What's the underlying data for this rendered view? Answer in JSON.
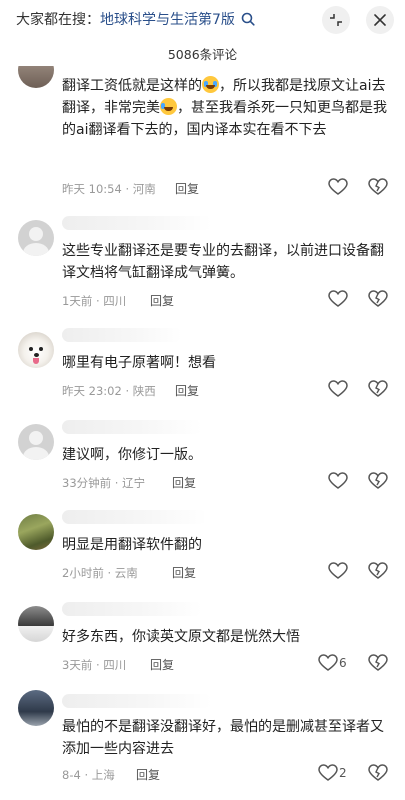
{
  "header": {
    "search_prefix": "大家都在搜：",
    "search_topic": "地球科学与生活第7版",
    "search_arrow": "Q",
    "comment_count": "5086条评论"
  },
  "icons": {
    "collapse": "collapse-icon",
    "close": "close-icon",
    "like": "heart-icon",
    "dislike": "broken-heart-icon"
  },
  "comments": [
    {
      "text_a": "翻译工资低就是这样的",
      "text_b": "，所以我都是找原文让ai去翻译，非常完美",
      "text_c": "，甚至我看杀死一只知更鸟都是我的ai翻译看下去的，国内译本实在看不下去",
      "meta": "昨天 10:54 · 河南",
      "reply": "回复",
      "likes": ""
    },
    {
      "text": "这些专业翻译还是要专业的去翻译，以前进口设备翻译文档将气缸翻译成气弹簧。",
      "meta": "1天前 · 四川",
      "reply": "回复",
      "likes": ""
    },
    {
      "text": "哪里有电子原著啊！想看",
      "meta": "昨天 23:02 · 陕西",
      "reply": "回复",
      "likes": ""
    },
    {
      "text": "建议啊，你修订一版。",
      "meta": "33分钟前 · 辽宁",
      "reply": "回复",
      "likes": ""
    },
    {
      "text": "明显是用翻译软件翻的",
      "meta": "2小时前 · 云南",
      "reply": "回复",
      "likes": ""
    },
    {
      "text": "好多东西，你读英文原文都是恍然大悟",
      "meta": "3天前 · 四川",
      "reply": "回复",
      "likes": "6"
    },
    {
      "text": "最怕的不是翻译没翻译好，最怕的是删减甚至译者又添加一些内容进去",
      "meta": "8-4 · 上海",
      "reply": "回复",
      "likes": "2"
    }
  ]
}
